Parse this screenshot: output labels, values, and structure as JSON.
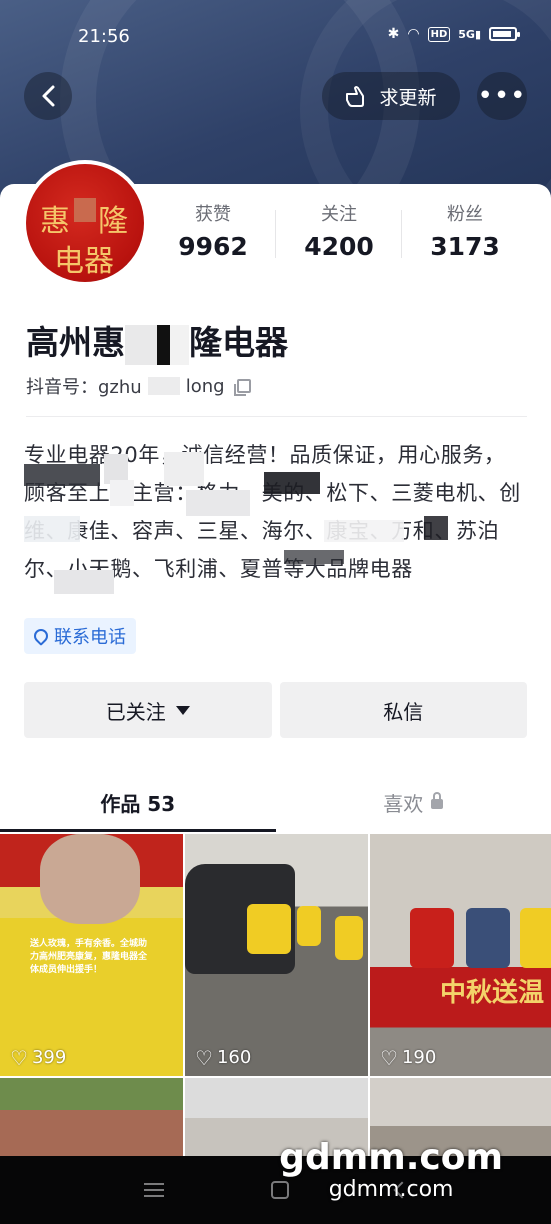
{
  "status_bar": {
    "time": "21:56",
    "hd_badge": "HD",
    "network": "5G"
  },
  "topbar": {
    "update_label": "求更新",
    "more_label": "•••"
  },
  "avatar": {
    "line1_left": "惠",
    "line1_right": "隆",
    "line2": "电器"
  },
  "stats": [
    {
      "label": "获赞",
      "value": "9962"
    },
    {
      "label": "关注",
      "value": "4200"
    },
    {
      "label": "粉丝",
      "value": "3173"
    }
  ],
  "profile": {
    "name_prefix": "高州惠",
    "name_suffix": "隆电器",
    "account_prefix": "抖音号：gzhu",
    "account_suffix": "long"
  },
  "bio": "专业电器20年，诚信经营！品质保证，用心服务，顾客至上！主营：格力、美的、松下、三菱电机、创维、康佳、容声、三星、海尔、康宝、万和、苏泊尔、小天鹅、飞利浦、夏普等大品牌电器",
  "contact_chip": "联系电话",
  "actions": {
    "follow_label": "已关注",
    "message_label": "私信"
  },
  "tabs": {
    "works_label": "作品 53",
    "likes_label": "喜欢"
  },
  "videos": [
    {
      "likes": "399",
      "caption": "送人玫瑰，手有余香。全城助力高州肥亮康复，惠隆电器全体成员伸出援手！"
    },
    {
      "likes": "160"
    },
    {
      "likes": "190",
      "banner": "中秋送温"
    },
    {
      "likes": ""
    },
    {
      "likes": ""
    },
    {
      "likes": ""
    }
  ],
  "watermark": {
    "big": "gdmm.com",
    "small": "gdmm.com"
  }
}
